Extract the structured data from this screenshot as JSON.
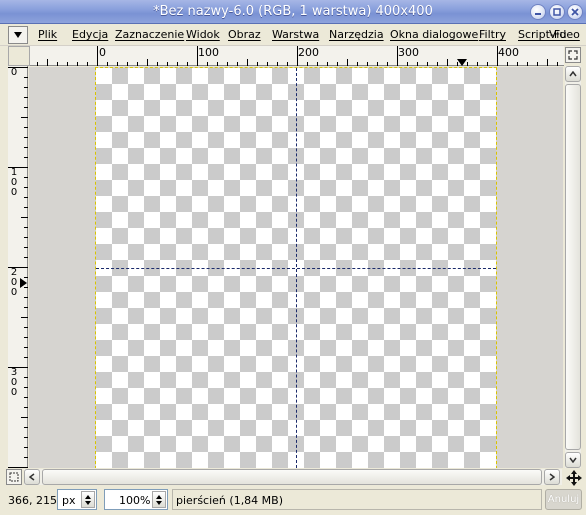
{
  "window": {
    "title": "*Bez nazwy-6.0 (RGB, 1 warstwa) 400x400",
    "controls": [
      "minimize",
      "maximize",
      "close"
    ]
  },
  "menubar": {
    "items": [
      {
        "label": "Plik"
      },
      {
        "label": "Edycja"
      },
      {
        "label": "Zaznaczenie"
      },
      {
        "label": "Widok"
      },
      {
        "label": "Obraz"
      },
      {
        "label": "Warstwa"
      },
      {
        "label": "Narzędzia"
      },
      {
        "label": "Okna dialogowe"
      },
      {
        "label": "Filtry"
      },
      {
        "label": "Script-Fu"
      },
      {
        "label": "Video"
      }
    ]
  },
  "rulers": {
    "horizontal_labels": [
      "0",
      "100",
      "200",
      "300",
      "400"
    ],
    "vertical_labels": [
      "0",
      "100",
      "200",
      "300"
    ]
  },
  "canvas": {
    "image_size": "400x400",
    "background": "transparent-checkerboard",
    "guides": [
      "vertical at 200",
      "horizontal at 200"
    ],
    "selection_color": "#d8c400",
    "guide_color": "#1a2a6a"
  },
  "statusbar": {
    "coords": "366, 215",
    "unit": "px",
    "zoom": "100%",
    "message": "pierścień (1,84 MB)",
    "cancel_label": "Anuluj"
  },
  "icons": {
    "menu_arrow": "menu-arrow-icon",
    "quick_mask": "quick-mask-icon",
    "navigate": "navigate-icon",
    "zoom_fit": "zoom-image-icon"
  }
}
